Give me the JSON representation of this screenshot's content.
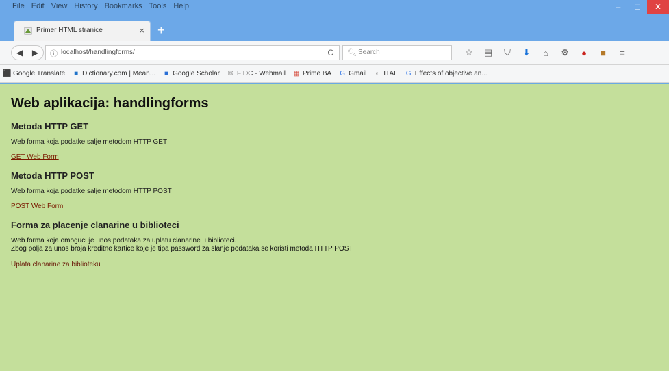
{
  "menu": [
    "File",
    "Edit",
    "View",
    "History",
    "Bookmarks",
    "Tools",
    "Help"
  ],
  "window_controls": {
    "minimize": "–",
    "maximize": "□",
    "close": "✕"
  },
  "tab": {
    "title": "Primer HTML stranice",
    "close": "×",
    "new_tab": "+"
  },
  "nav": {
    "back": "◀",
    "forward": "▶",
    "url": "localhost/handlingforms/",
    "reload": "C",
    "search_placeholder": "Search"
  },
  "bookmarks": [
    {
      "label": "Google Translate",
      "icon": "translate-icon"
    },
    {
      "label": "Dictionary.com | Mean...",
      "icon": "dictionary-icon"
    },
    {
      "label": "Google Scholar",
      "icon": "scholar-icon"
    },
    {
      "label": "FIDC - Webmail",
      "icon": "mail-icon"
    },
    {
      "label": "Prime BA",
      "icon": "grid-icon"
    },
    {
      "label": "Gmail",
      "icon": "google-icon"
    },
    {
      "label": "ITAL",
      "icon": "globe-icon"
    },
    {
      "label": "Effects of objective an...",
      "icon": "google-icon"
    }
  ],
  "page": {
    "title": "Web aplikacija: handlingforms",
    "sections": [
      {
        "heading": "Metoda HTTP GET",
        "text": "Web forma koja podatke salje metodom HTTP GET",
        "link": "GET Web Form"
      },
      {
        "heading": "Metoda HTTP POST",
        "text": "Web forma koja podatke salje metodom HTTP POST",
        "link": "POST Web Form"
      }
    ],
    "section3": {
      "heading": "Forma za placenje clanarine u biblioteci",
      "line1": "Web forma koja omogucuje unos podataka za uplatu clanarine u biblioteci.",
      "line2": "Zbog polja za unos broja kreditne kartice koje je tipa password za slanje podataka se koristi metoda HTTP POST",
      "link": "Uplata clanarine za biblioteku"
    }
  }
}
